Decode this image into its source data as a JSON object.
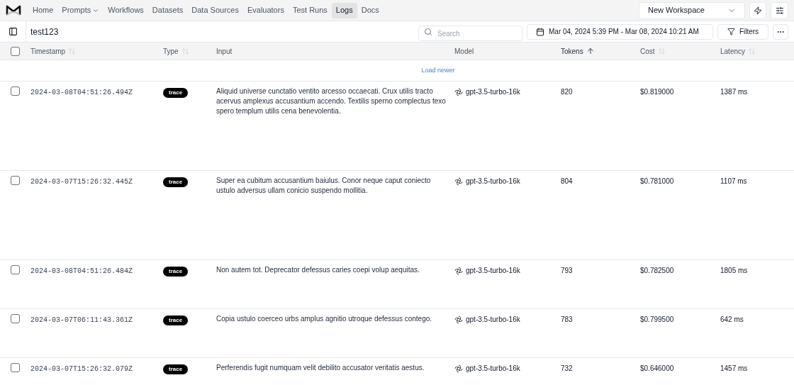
{
  "nav": {
    "items": [
      {
        "label": "Home",
        "selected": false,
        "dropdown": false
      },
      {
        "label": "Prompts",
        "selected": false,
        "dropdown": true
      },
      {
        "label": "Workflows",
        "selected": false,
        "dropdown": false
      },
      {
        "label": "Datasets",
        "selected": false,
        "dropdown": false
      },
      {
        "label": "Data Sources",
        "selected": false,
        "dropdown": false
      },
      {
        "label": "Evaluators",
        "selected": false,
        "dropdown": false
      },
      {
        "label": "Test Runs",
        "selected": false,
        "dropdown": false
      },
      {
        "label": "Logs",
        "selected": true,
        "dropdown": false
      },
      {
        "label": "Docs",
        "selected": false,
        "dropdown": false
      }
    ],
    "workspace": "New Workspace"
  },
  "toolbar": {
    "title": "test123",
    "search": {
      "placeholder": "Search"
    },
    "date_range": "Mar 04, 2024 5:39 PM - Mar 08, 2024 10:21 AM",
    "filters": "Filters"
  },
  "table": {
    "columns": [
      {
        "label": "Timestamp",
        "sortable": true,
        "sorted": false
      },
      {
        "label": "Type",
        "sortable": true,
        "sorted": false
      },
      {
        "label": "Input",
        "sortable": false,
        "sorted": false
      },
      {
        "label": "Model",
        "sortable": false,
        "sorted": false
      },
      {
        "label": "Tokens",
        "sortable": true,
        "sorted": true
      },
      {
        "label": "Cost",
        "sortable": true,
        "sorted": false
      },
      {
        "label": "Latency",
        "sortable": true,
        "sorted": false
      }
    ],
    "all_checked": false,
    "load_newer": "Load newer",
    "rows": [
      {
        "checked": false,
        "timestamp": "2024-03-08T04:51:26.494Z",
        "type": "trace",
        "input": "Aliquid universe cunctatio ventito arcesso occaecati. Crux utilis tracto acervus amplexus accusantium accendo. Textilis sperno complectus texo spero templum utilis cena benevolentia.",
        "model": "gpt-3.5-turbo-16k",
        "tokens": "820",
        "cost": "$0.819000",
        "latency": "1387 ms",
        "expanded": true
      },
      {
        "checked": false,
        "timestamp": "2024-03-07T15:26:32.445Z",
        "type": "trace",
        "input": "Super ea cubitum accusantium baiulus. Conor neque caput coniecto ustulo adversus ullam conicio suspendo mollitia.",
        "model": "gpt-3.5-turbo-16k",
        "tokens": "804",
        "cost": "$0.781000",
        "latency": "1107 ms",
        "expanded": true
      },
      {
        "checked": false,
        "timestamp": "2024-03-08T04:51:26.484Z",
        "type": "trace",
        "input": "Non autem tot. Deprecator defessus caries coepi volup aequitas.",
        "model": "gpt-3.5-turbo-16k",
        "tokens": "793",
        "cost": "$0.782500",
        "latency": "1805 ms",
        "expanded": false
      },
      {
        "checked": false,
        "timestamp": "2024-03-07T06:11:43.361Z",
        "type": "trace",
        "input": "Copia ustulo coerceo urbs amplus agnitio utroque defessus contego.",
        "model": "gpt-3.5-turbo-16k",
        "tokens": "783",
        "cost": "$0.799500",
        "latency": "642 ms",
        "expanded": false
      },
      {
        "checked": false,
        "timestamp": "2024-03-07T15:26:32.079Z",
        "type": "trace",
        "input": "Perferendis fugit numquam velit debilito accusator veritatis aestus.",
        "model": "gpt-3.5-turbo-16k",
        "tokens": "732",
        "cost": "$0.646000",
        "latency": "1457 ms"
      }
    ]
  }
}
